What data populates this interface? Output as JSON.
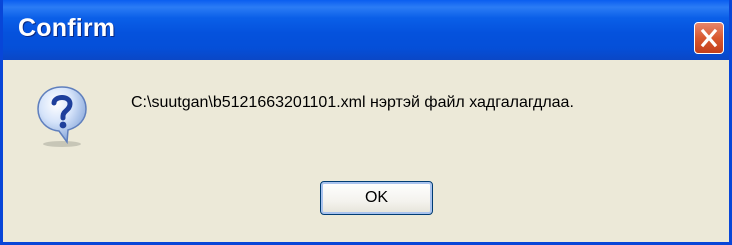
{
  "window": {
    "title": "Confirm",
    "close_icon": "close-icon"
  },
  "dialog": {
    "icon": "question-icon",
    "message": "C:\\suutgan\\b5121663201101.xml нэртэй файл хадгалагдлаа.",
    "ok_label": "OK"
  },
  "colors": {
    "titlebar": "#0552dd",
    "frame": "#0846d8",
    "body": "#ece9d8",
    "close_button": "#d9582f"
  }
}
